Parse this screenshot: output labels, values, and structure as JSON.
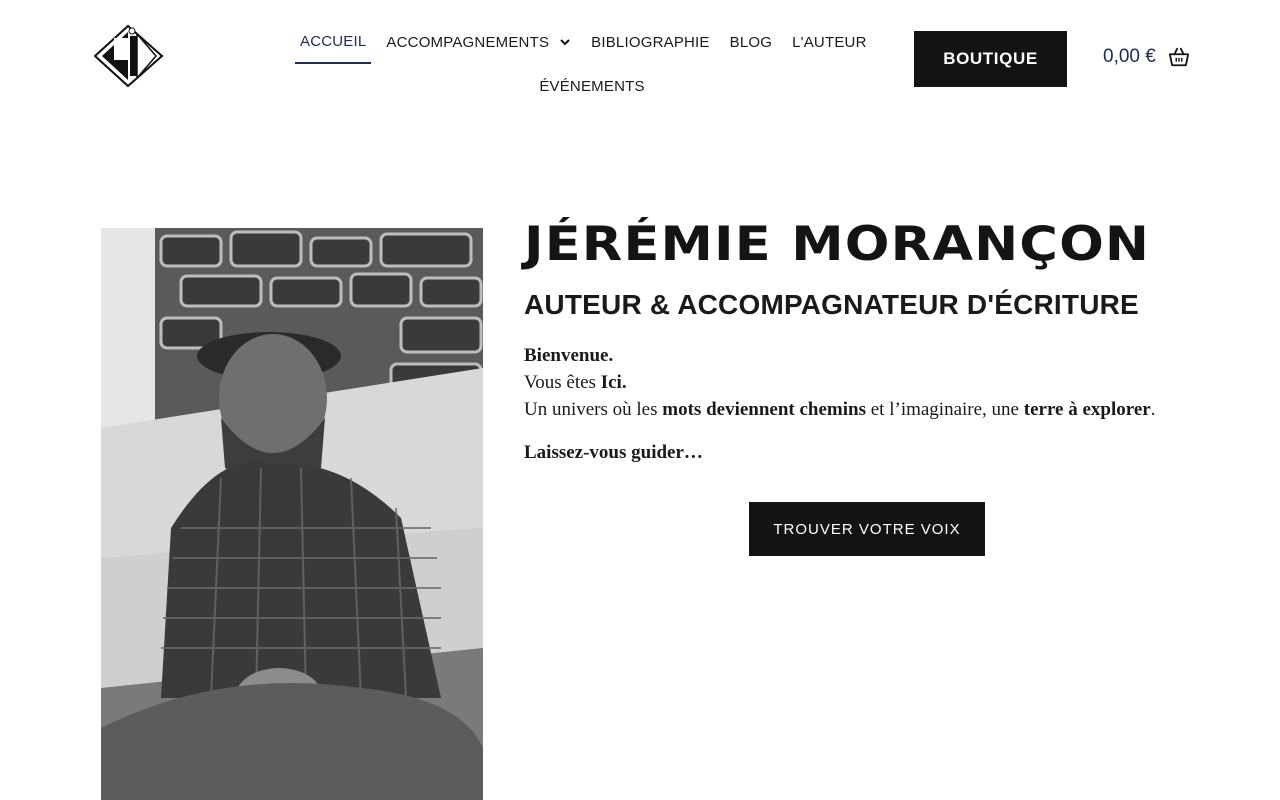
{
  "header": {
    "logo_name": "logo-diamond",
    "nav": [
      {
        "label": "ACCUEIL",
        "active": true
      },
      {
        "label": "ACCOMPAGNEMENTS",
        "has_dropdown": true
      },
      {
        "label": "BIBLIOGRAPHIE"
      },
      {
        "label": "BLOG"
      },
      {
        "label": "L'AUTEUR"
      },
      {
        "label": "ÉVÉNEMENTS"
      }
    ],
    "boutique_label": "BOUTIQUE",
    "cart_amount": "0,00 €",
    "accent_color": "#1e2a5a"
  },
  "hero": {
    "name": "JÉRÉMIE MORANÇON",
    "subtitle": "AUTEUR & ACCOMPAGNATEUR D'ÉCRITURE",
    "welcome": "Bienvenue.",
    "line2_pre": "Vous êtes ",
    "line2_bold": "Ici.",
    "line3_pre": "Un univers où les ",
    "line3_bold1": "mots deviennent chemins",
    "line3_mid": " et l’imaginaire, une ",
    "line3_bold2": "terre à explorer",
    "line3_end": ".",
    "guide": "Laissez-vous guider…",
    "cta_label": "TROUVER VOTRE VOIX"
  }
}
